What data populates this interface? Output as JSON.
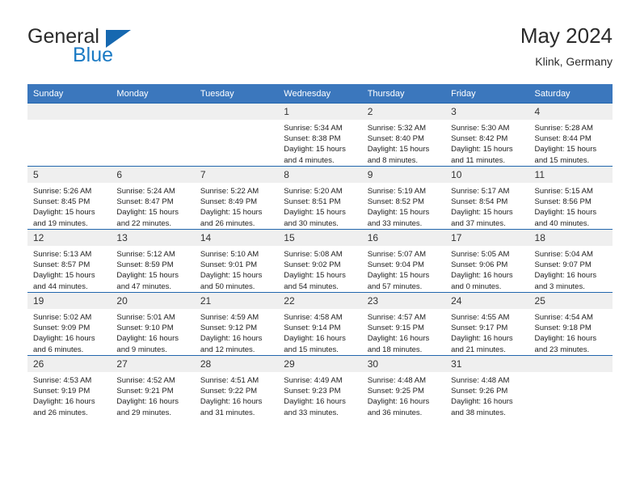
{
  "logo": {
    "word_one": "General",
    "word_two": "Blue",
    "triangle_icon": "triangle-icon",
    "brand_blue": "#1b7ac4",
    "brand_dark": "#2b2b2b"
  },
  "header": {
    "title": "May 2024",
    "subtitle": "Klink, Germany"
  },
  "theme": {
    "header_blue": "#3b77bd",
    "row_border_blue": "#2166ad",
    "daynum_band": "#efefef",
    "page_background": "#ffffff"
  },
  "calendar": {
    "weekday_headers": [
      "Sunday",
      "Monday",
      "Tuesday",
      "Wednesday",
      "Thursday",
      "Friday",
      "Saturday"
    ],
    "labels": {
      "sunrise_prefix": "Sunrise:",
      "sunset_prefix": "Sunset:",
      "daylight_prefix": "Daylight:"
    },
    "weeks": [
      [
        {
          "day": "",
          "sunrise": "",
          "sunset": "",
          "daylight_a": "",
          "daylight_b": "",
          "empty": true
        },
        {
          "day": "",
          "sunrise": "",
          "sunset": "",
          "daylight_a": "",
          "daylight_b": "",
          "empty": true
        },
        {
          "day": "",
          "sunrise": "",
          "sunset": "",
          "daylight_a": "",
          "daylight_b": "",
          "empty": true
        },
        {
          "day": "1",
          "sunrise": "Sunrise: 5:34 AM",
          "sunset": "Sunset: 8:38 PM",
          "daylight_a": "Daylight: 15 hours",
          "daylight_b": "and 4 minutes."
        },
        {
          "day": "2",
          "sunrise": "Sunrise: 5:32 AM",
          "sunset": "Sunset: 8:40 PM",
          "daylight_a": "Daylight: 15 hours",
          "daylight_b": "and 8 minutes."
        },
        {
          "day": "3",
          "sunrise": "Sunrise: 5:30 AM",
          "sunset": "Sunset: 8:42 PM",
          "daylight_a": "Daylight: 15 hours",
          "daylight_b": "and 11 minutes."
        },
        {
          "day": "4",
          "sunrise": "Sunrise: 5:28 AM",
          "sunset": "Sunset: 8:44 PM",
          "daylight_a": "Daylight: 15 hours",
          "daylight_b": "and 15 minutes."
        }
      ],
      [
        {
          "day": "5",
          "sunrise": "Sunrise: 5:26 AM",
          "sunset": "Sunset: 8:45 PM",
          "daylight_a": "Daylight: 15 hours",
          "daylight_b": "and 19 minutes."
        },
        {
          "day": "6",
          "sunrise": "Sunrise: 5:24 AM",
          "sunset": "Sunset: 8:47 PM",
          "daylight_a": "Daylight: 15 hours",
          "daylight_b": "and 22 minutes."
        },
        {
          "day": "7",
          "sunrise": "Sunrise: 5:22 AM",
          "sunset": "Sunset: 8:49 PM",
          "daylight_a": "Daylight: 15 hours",
          "daylight_b": "and 26 minutes."
        },
        {
          "day": "8",
          "sunrise": "Sunrise: 5:20 AM",
          "sunset": "Sunset: 8:51 PM",
          "daylight_a": "Daylight: 15 hours",
          "daylight_b": "and 30 minutes."
        },
        {
          "day": "9",
          "sunrise": "Sunrise: 5:19 AM",
          "sunset": "Sunset: 8:52 PM",
          "daylight_a": "Daylight: 15 hours",
          "daylight_b": "and 33 minutes."
        },
        {
          "day": "10",
          "sunrise": "Sunrise: 5:17 AM",
          "sunset": "Sunset: 8:54 PM",
          "daylight_a": "Daylight: 15 hours",
          "daylight_b": "and 37 minutes."
        },
        {
          "day": "11",
          "sunrise": "Sunrise: 5:15 AM",
          "sunset": "Sunset: 8:56 PM",
          "daylight_a": "Daylight: 15 hours",
          "daylight_b": "and 40 minutes."
        }
      ],
      [
        {
          "day": "12",
          "sunrise": "Sunrise: 5:13 AM",
          "sunset": "Sunset: 8:57 PM",
          "daylight_a": "Daylight: 15 hours",
          "daylight_b": "and 44 minutes."
        },
        {
          "day": "13",
          "sunrise": "Sunrise: 5:12 AM",
          "sunset": "Sunset: 8:59 PM",
          "daylight_a": "Daylight: 15 hours",
          "daylight_b": "and 47 minutes."
        },
        {
          "day": "14",
          "sunrise": "Sunrise: 5:10 AM",
          "sunset": "Sunset: 9:01 PM",
          "daylight_a": "Daylight: 15 hours",
          "daylight_b": "and 50 minutes."
        },
        {
          "day": "15",
          "sunrise": "Sunrise: 5:08 AM",
          "sunset": "Sunset: 9:02 PM",
          "daylight_a": "Daylight: 15 hours",
          "daylight_b": "and 54 minutes."
        },
        {
          "day": "16",
          "sunrise": "Sunrise: 5:07 AM",
          "sunset": "Sunset: 9:04 PM",
          "daylight_a": "Daylight: 15 hours",
          "daylight_b": "and 57 minutes."
        },
        {
          "day": "17",
          "sunrise": "Sunrise: 5:05 AM",
          "sunset": "Sunset: 9:06 PM",
          "daylight_a": "Daylight: 16 hours",
          "daylight_b": "and 0 minutes."
        },
        {
          "day": "18",
          "sunrise": "Sunrise: 5:04 AM",
          "sunset": "Sunset: 9:07 PM",
          "daylight_a": "Daylight: 16 hours",
          "daylight_b": "and 3 minutes."
        }
      ],
      [
        {
          "day": "19",
          "sunrise": "Sunrise: 5:02 AM",
          "sunset": "Sunset: 9:09 PM",
          "daylight_a": "Daylight: 16 hours",
          "daylight_b": "and 6 minutes."
        },
        {
          "day": "20",
          "sunrise": "Sunrise: 5:01 AM",
          "sunset": "Sunset: 9:10 PM",
          "daylight_a": "Daylight: 16 hours",
          "daylight_b": "and 9 minutes."
        },
        {
          "day": "21",
          "sunrise": "Sunrise: 4:59 AM",
          "sunset": "Sunset: 9:12 PM",
          "daylight_a": "Daylight: 16 hours",
          "daylight_b": "and 12 minutes."
        },
        {
          "day": "22",
          "sunrise": "Sunrise: 4:58 AM",
          "sunset": "Sunset: 9:14 PM",
          "daylight_a": "Daylight: 16 hours",
          "daylight_b": "and 15 minutes."
        },
        {
          "day": "23",
          "sunrise": "Sunrise: 4:57 AM",
          "sunset": "Sunset: 9:15 PM",
          "daylight_a": "Daylight: 16 hours",
          "daylight_b": "and 18 minutes."
        },
        {
          "day": "24",
          "sunrise": "Sunrise: 4:55 AM",
          "sunset": "Sunset: 9:17 PM",
          "daylight_a": "Daylight: 16 hours",
          "daylight_b": "and 21 minutes."
        },
        {
          "day": "25",
          "sunrise": "Sunrise: 4:54 AM",
          "sunset": "Sunset: 9:18 PM",
          "daylight_a": "Daylight: 16 hours",
          "daylight_b": "and 23 minutes."
        }
      ],
      [
        {
          "day": "26",
          "sunrise": "Sunrise: 4:53 AM",
          "sunset": "Sunset: 9:19 PM",
          "daylight_a": "Daylight: 16 hours",
          "daylight_b": "and 26 minutes."
        },
        {
          "day": "27",
          "sunrise": "Sunrise: 4:52 AM",
          "sunset": "Sunset: 9:21 PM",
          "daylight_a": "Daylight: 16 hours",
          "daylight_b": "and 29 minutes."
        },
        {
          "day": "28",
          "sunrise": "Sunrise: 4:51 AM",
          "sunset": "Sunset: 9:22 PM",
          "daylight_a": "Daylight: 16 hours",
          "daylight_b": "and 31 minutes."
        },
        {
          "day": "29",
          "sunrise": "Sunrise: 4:49 AM",
          "sunset": "Sunset: 9:23 PM",
          "daylight_a": "Daylight: 16 hours",
          "daylight_b": "and 33 minutes."
        },
        {
          "day": "30",
          "sunrise": "Sunrise: 4:48 AM",
          "sunset": "Sunset: 9:25 PM",
          "daylight_a": "Daylight: 16 hours",
          "daylight_b": "and 36 minutes."
        },
        {
          "day": "31",
          "sunrise": "Sunrise: 4:48 AM",
          "sunset": "Sunset: 9:26 PM",
          "daylight_a": "Daylight: 16 hours",
          "daylight_b": "and 38 minutes."
        },
        {
          "day": "",
          "sunrise": "",
          "sunset": "",
          "daylight_a": "",
          "daylight_b": "",
          "empty": true
        }
      ]
    ]
  }
}
